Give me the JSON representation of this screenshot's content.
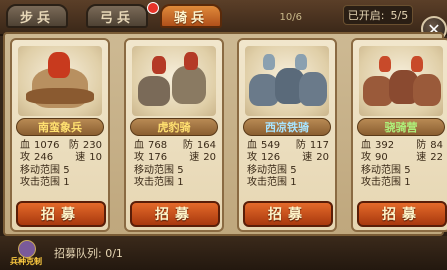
{
  "tabs": [
    {
      "label": "步兵",
      "active": false
    },
    {
      "label": "弓兵",
      "active": false,
      "badge": true
    },
    {
      "label": "骑兵",
      "active": true
    }
  ],
  "header": {
    "bg_text": "10/6",
    "opened_label": "已开启:",
    "opened_value": "5/5"
  },
  "units": [
    {
      "name": "南蛮象兵",
      "name_color": "yellow",
      "blood_label": "血",
      "blood": "1076",
      "def_label": "防",
      "def": "230",
      "atk_label": "攻",
      "atk": "246",
      "spd_label": "速",
      "spd": "10",
      "move_label": "移动范围",
      "move": "5",
      "range_label": "攻击范围",
      "range": "1",
      "button": "招募"
    },
    {
      "name": "虎豹骑",
      "name_color": "yellow",
      "blood_label": "血",
      "blood": "768",
      "def_label": "防",
      "def": "164",
      "atk_label": "攻",
      "atk": "176",
      "spd_label": "速",
      "spd": "20",
      "move_label": "移动范围",
      "move": "5",
      "range_label": "攻击范围",
      "range": "1",
      "button": "招募"
    },
    {
      "name": "西凉铁骑",
      "name_color": "blue",
      "blood_label": "血",
      "blood": "549",
      "def_label": "防",
      "def": "117",
      "atk_label": "攻",
      "atk": "126",
      "spd_label": "速",
      "spd": "20",
      "move_label": "移动范围",
      "move": "5",
      "range_label": "攻击范围",
      "range": "1",
      "button": "招募"
    },
    {
      "name": "骁骑营",
      "name_color": "green",
      "blood_label": "血",
      "blood": "392",
      "def_label": "防",
      "def": "84",
      "atk_label": "攻",
      "atk": "90",
      "spd_label": "速",
      "spd": "22",
      "move_label": "移动范围",
      "move": "5",
      "range_label": "攻击范围",
      "range": "1",
      "button": "招募"
    }
  ],
  "footer": {
    "icon_label": "兵种克制",
    "queue_label": "招募队列:",
    "queue_value": "0/1"
  },
  "icons": [
    "close-icon",
    "unit-counter-icon"
  ]
}
